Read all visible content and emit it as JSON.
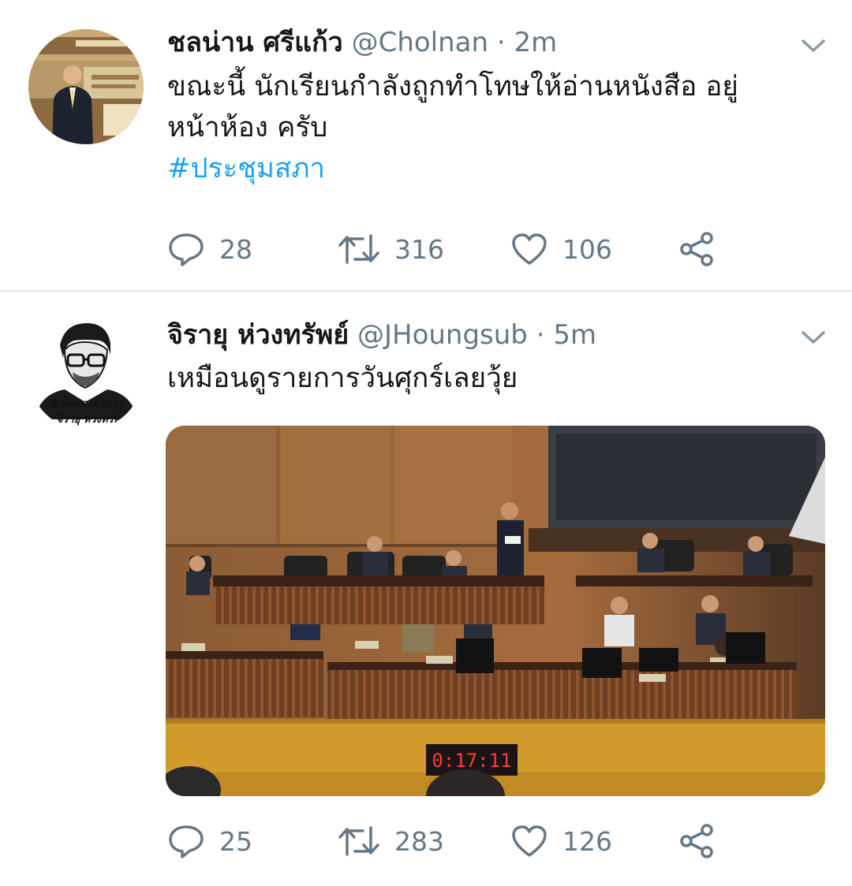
{
  "tweets": [
    {
      "name": "ชลน่าน ศรีแก้ว",
      "handle": "@Cholnan",
      "separator": "·",
      "time": "2m",
      "text_line1": "ขณะนี้ นักเรียนกำลังถูกทำโทษให้อ่านหนังสือ อยู่",
      "text_line2": "หน้าห้อง ครับ",
      "hashtag": "#ประชุมสภา",
      "replies": "28",
      "retweets": "316",
      "likes": "106"
    },
    {
      "name": "จิรายุ ห่วงทรัพย์",
      "handle": "@JHoungsub",
      "separator": "·",
      "time": "5m",
      "text_line1": "เหมือนดูรายการวันศุกร์เลยวุ้ย",
      "avatar_caption_line1": "รักษ์คลองสามวา",
      "avatar_caption_line2": "จิรายุ ห่วงทรัพ",
      "clock_reading": "0:17:11",
      "replies": "25",
      "retweets": "283",
      "likes": "126"
    }
  ],
  "colors": {
    "text": "#14171a",
    "secondary": "#657786",
    "link": "#1da1f2",
    "divider": "#e1e8ed"
  },
  "icons": [
    "reply-icon",
    "retweet-icon",
    "like-icon",
    "share-icon",
    "chevron-down-icon"
  ]
}
